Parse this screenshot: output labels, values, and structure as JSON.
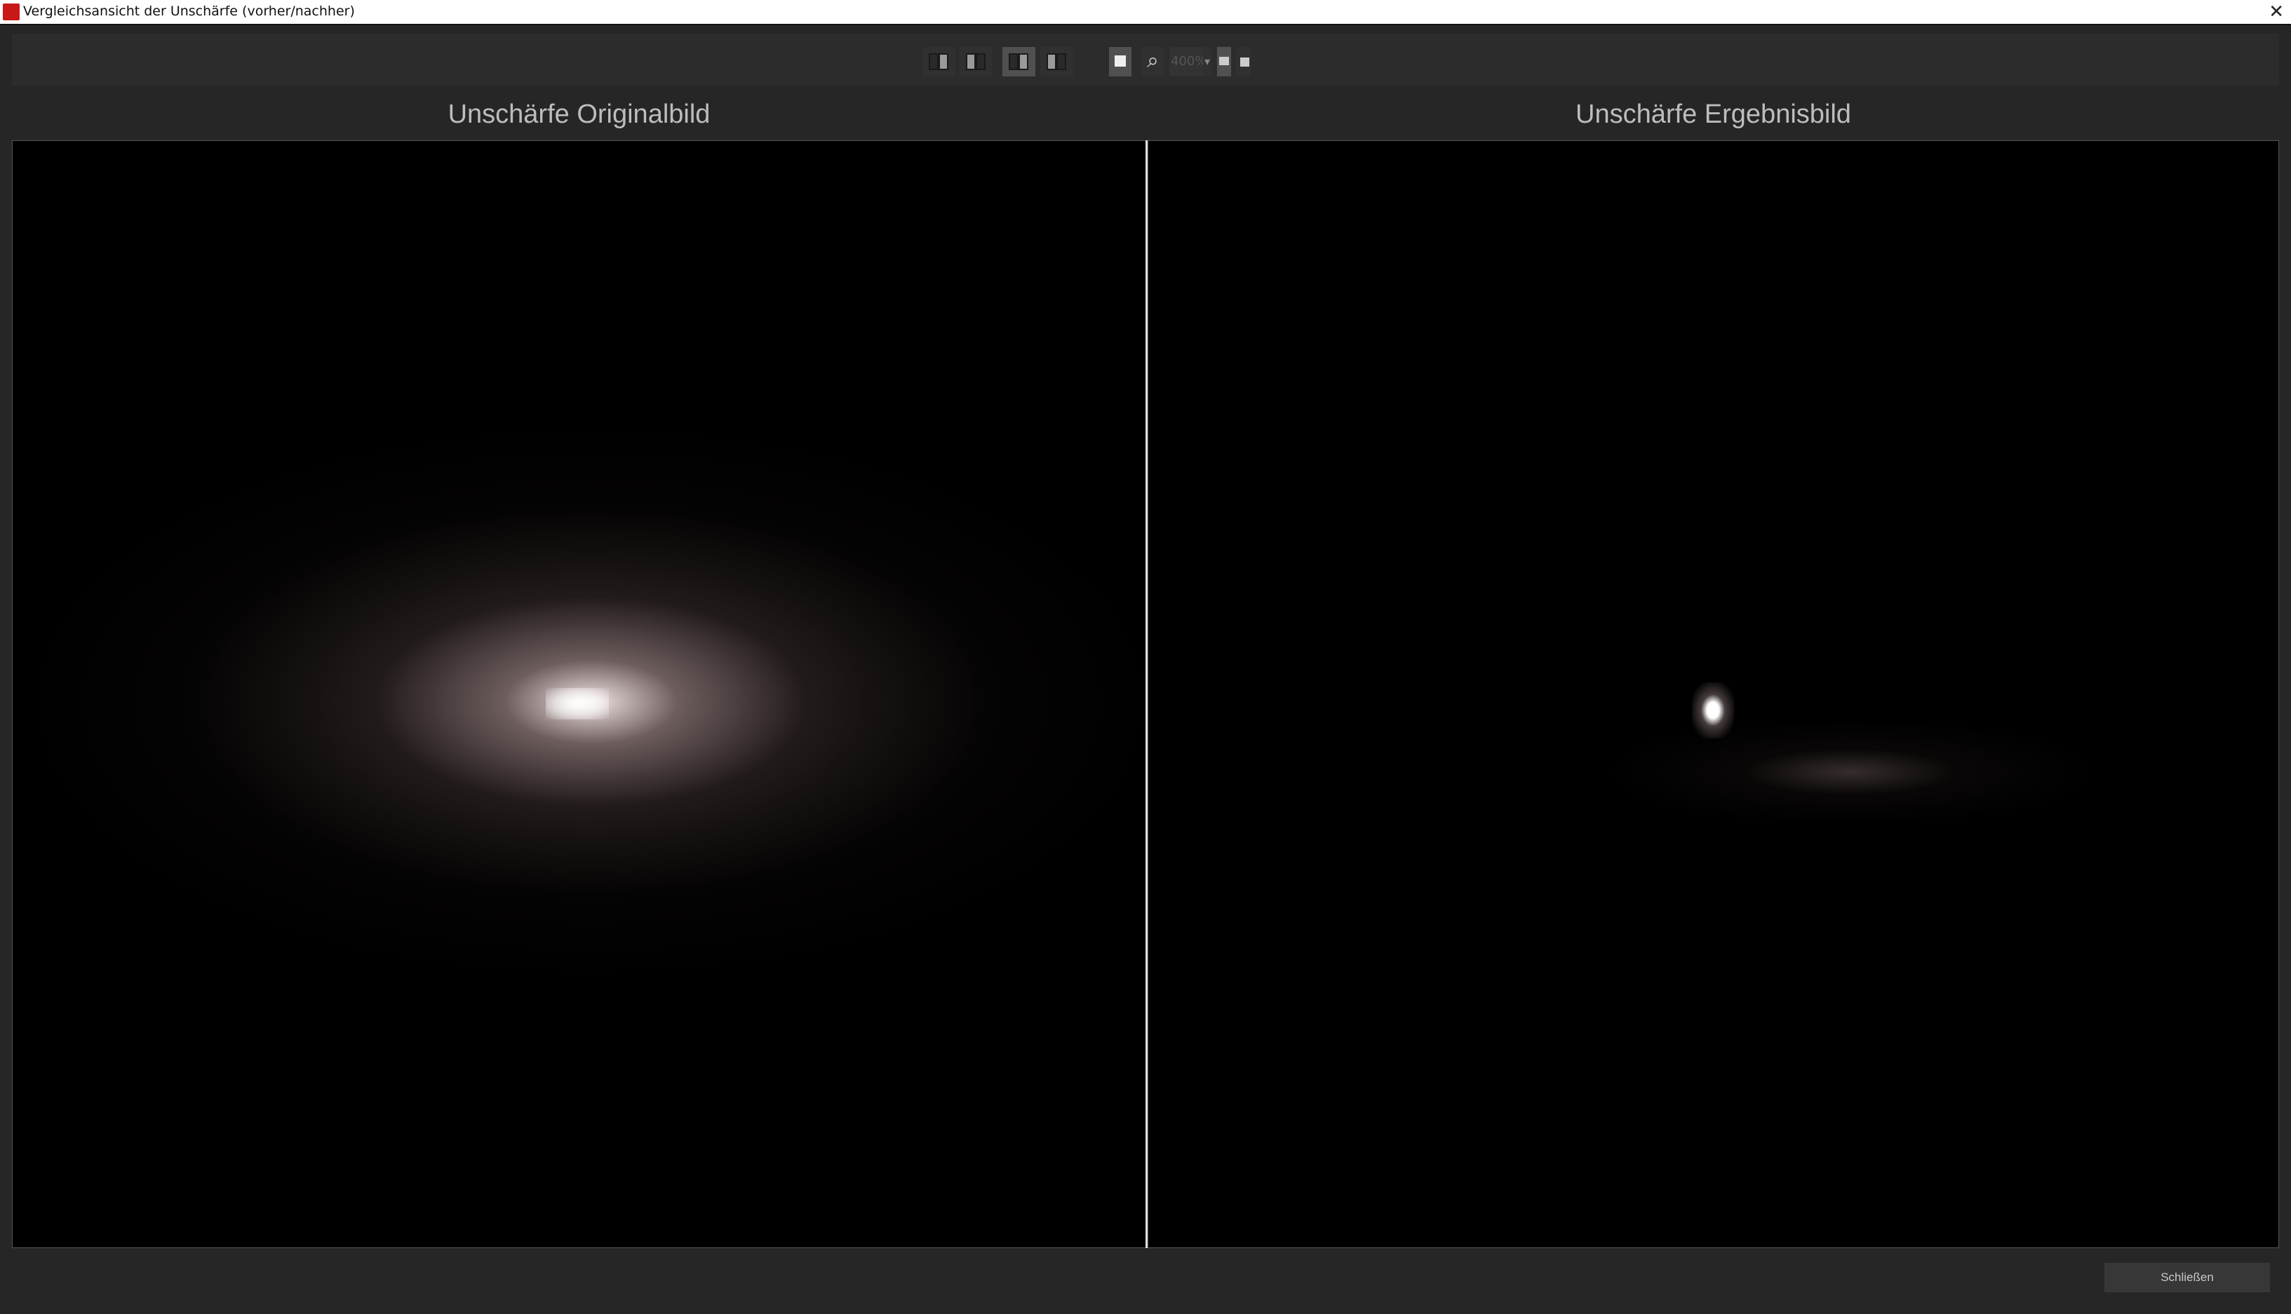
{
  "window": {
    "title": "Vergleichsansicht der Unschärfe (vorher/nachher)",
    "close_glyph": "✕"
  },
  "toolbar": {
    "zoom_value": "400%",
    "dropdown_glyph": "▾",
    "zoom_glyph": "⌕"
  },
  "panels": {
    "left_title": "Unschärfe Originalbild",
    "right_title": "Unschärfe Ergebnisbild"
  },
  "footer": {
    "close_label": "Schließen"
  }
}
